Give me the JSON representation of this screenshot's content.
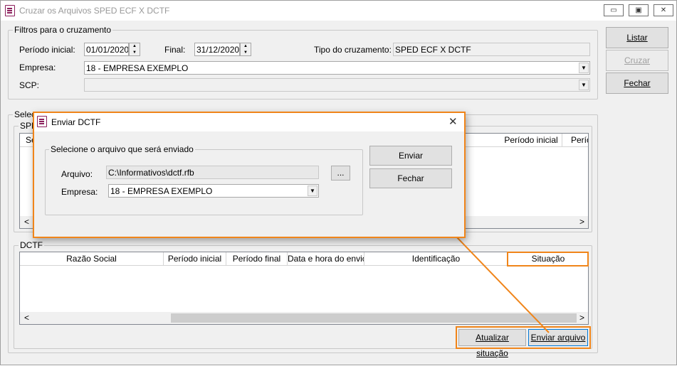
{
  "window": {
    "title": "Cruzar os Arquivos SPED ECF X DCTF",
    "min": "▭",
    "max": "▣",
    "close": "✕"
  },
  "filters": {
    "group_label": "Filtros para o cruzamento",
    "periodo_inicial_label": "Período inicial:",
    "periodo_inicial": "01/01/2020",
    "final_label": "Final:",
    "final": "31/12/2020",
    "tipo_label": "Tipo do cruzamento:",
    "tipo": "SPED ECF X DCTF",
    "empresa_label": "Empresa:",
    "empresa": "18 - EMPRESA EXEMPLO",
    "scp_label": "SCP:",
    "scp": ""
  },
  "buttons": {
    "listar": "Listar",
    "cruzar": "Cruzar",
    "fechar": "Fechar"
  },
  "select_group": {
    "label": "Selec"
  },
  "sped": {
    "label": "SPE",
    "col_first": "Se",
    "col_periodo": "Período inicial",
    "col_last": "Perío"
  },
  "dctf": {
    "label": "DCTF",
    "columns": [
      "Razão Social",
      "Período inicial",
      "Período final",
      "Data e hora do envio",
      "Identificação",
      "Situação"
    ],
    "atualizar": "Atualizar situação",
    "enviar": "Enviar arquivo"
  },
  "dialog": {
    "title": "Enviar DCTF",
    "group_label": "Selecione o arquivo que será enviado",
    "arquivo_label": "Arquivo:",
    "arquivo": "C:\\Informativos\\dctf.rfb",
    "browse": "...",
    "empresa_label": "Empresa:",
    "empresa": "18 - EMPRESA EXEMPLO",
    "enviar": "Enviar",
    "fechar": "Fechar"
  },
  "scroll": {
    "left": "<",
    "right": ">"
  },
  "colors": {
    "highlight": "#f0851a",
    "icon": "#8b1e5b"
  }
}
